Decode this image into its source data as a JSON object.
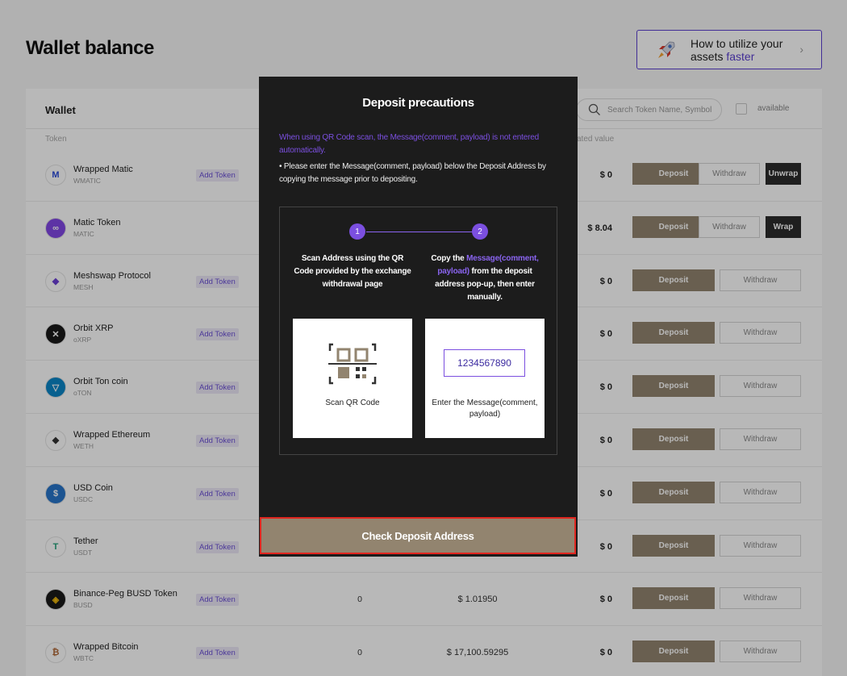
{
  "page": {
    "title": "Wallet balance",
    "promo": {
      "line1": "How to utilize your",
      "line2_prefix": "assets ",
      "line2_highlight": "faster"
    }
  },
  "card": {
    "label": "Wallet",
    "search_placeholder": "Search Token Name, Symbol",
    "available_label": "available",
    "columns": {
      "token": "Token",
      "estimated": "ated value"
    }
  },
  "tokens": [
    {
      "name": "Wrapped Matic",
      "symbol": "WMATIC",
      "add": "Add Token",
      "balance": "",
      "price": "",
      "value": "$ 0",
      "deposit": "Deposit",
      "withdraw": "Withdraw",
      "extra": "Unwrap",
      "color": "#ffffff",
      "glyph": "M",
      "glyphColor": "#2b4bd8"
    },
    {
      "name": "Matic Token",
      "symbol": "MATIC",
      "add": "",
      "balance": "",
      "price": "",
      "value": "$ 8.04",
      "deposit": "Deposit",
      "withdraw": "Withdraw",
      "extra": "Wrap",
      "color": "#8247e5",
      "glyph": "∞",
      "glyphColor": "#ffffff"
    },
    {
      "name": "Meshswap Protocol",
      "symbol": "MESH",
      "add": "Add Token",
      "balance": "",
      "price": "",
      "value": "$ 0",
      "deposit": "Deposit",
      "withdraw": "Withdraw",
      "extra": "",
      "color": "#ffffff",
      "glyph": "◆",
      "glyphColor": "#6b3fd4"
    },
    {
      "name": "Orbit XRP",
      "symbol": "oXRP",
      "add": "Add Token",
      "balance": "",
      "price": "",
      "value": "$ 0",
      "deposit": "Deposit",
      "withdraw": "Withdraw",
      "extra": "",
      "color": "#1a1a1a",
      "glyph": "✕",
      "glyphColor": "#ffffff"
    },
    {
      "name": "Orbit Ton coin",
      "symbol": "oTON",
      "add": "Add Token",
      "balance": "",
      "price": "",
      "value": "$ 0",
      "deposit": "Deposit",
      "withdraw": "Withdraw",
      "extra": "",
      "color": "#0b86c6",
      "glyph": "▽",
      "glyphColor": "#ffffff"
    },
    {
      "name": "Wrapped Ethereum",
      "symbol": "WETH",
      "add": "Add Token",
      "balance": "",
      "price": "",
      "value": "$ 0",
      "deposit": "Deposit",
      "withdraw": "Withdraw",
      "extra": "",
      "color": "#ffffff",
      "glyph": "◆",
      "glyphColor": "#333333"
    },
    {
      "name": "USD Coin",
      "symbol": "USDC",
      "add": "Add Token",
      "balance": "",
      "price": "",
      "value": "$ 0",
      "deposit": "Deposit",
      "withdraw": "Withdraw",
      "extra": "",
      "color": "#2775ca",
      "glyph": "$",
      "glyphColor": "#ffffff"
    },
    {
      "name": "Tether",
      "symbol": "USDT",
      "add": "Add Token",
      "balance": "",
      "price": "",
      "value": "$ 0",
      "deposit": "Deposit",
      "withdraw": "Withdraw",
      "extra": "",
      "color": "#ffffff",
      "glyph": "T",
      "glyphColor": "#26a17b"
    },
    {
      "name": "Binance-Peg BUSD Token",
      "symbol": "BUSD",
      "add": "Add Token",
      "balance": "0",
      "price": "$ 1.01950",
      "value": "$ 0",
      "deposit": "Deposit",
      "withdraw": "Withdraw",
      "extra": "",
      "color": "#1a1a1a",
      "glyph": "◈",
      "glyphColor": "#f0b90b"
    },
    {
      "name": "Wrapped Bitcoin",
      "symbol": "WBTC",
      "add": "Add Token",
      "balance": "0",
      "price": "$ 17,100.59295",
      "value": "$ 0",
      "deposit": "Deposit",
      "withdraw": "Withdraw",
      "extra": "",
      "color": "#ffffff",
      "glyph": "₿",
      "glyphColor": "#b06a3a"
    }
  ],
  "modal": {
    "title": "Deposit precautions",
    "warning": "When using QR Code scan, the Message(comment, payload) is not entered automatically.",
    "note": "• Please enter the Message(comment, payload) below the Deposit Address by copying the message prior to depositing.",
    "step1": {
      "num": "1",
      "text": "Scan Address using the QR Code provided by the exchange withdrawal page",
      "caption": "Scan QR Code"
    },
    "step2": {
      "num": "2",
      "text_prefix": "Copy the ",
      "text_highlight": "Message(comment, payload)",
      "text_suffix": " from the deposit address pop-up, then enter manually.",
      "sample": "1234567890",
      "caption": "Enter the Message(comment, payload)"
    },
    "confirm": "Check Deposit Address"
  },
  "colors": {
    "accent": "#7b4fe0",
    "deposit": "#92846f",
    "modal_bg": "#1c1c1c",
    "highlight_border": "#e0261f"
  }
}
